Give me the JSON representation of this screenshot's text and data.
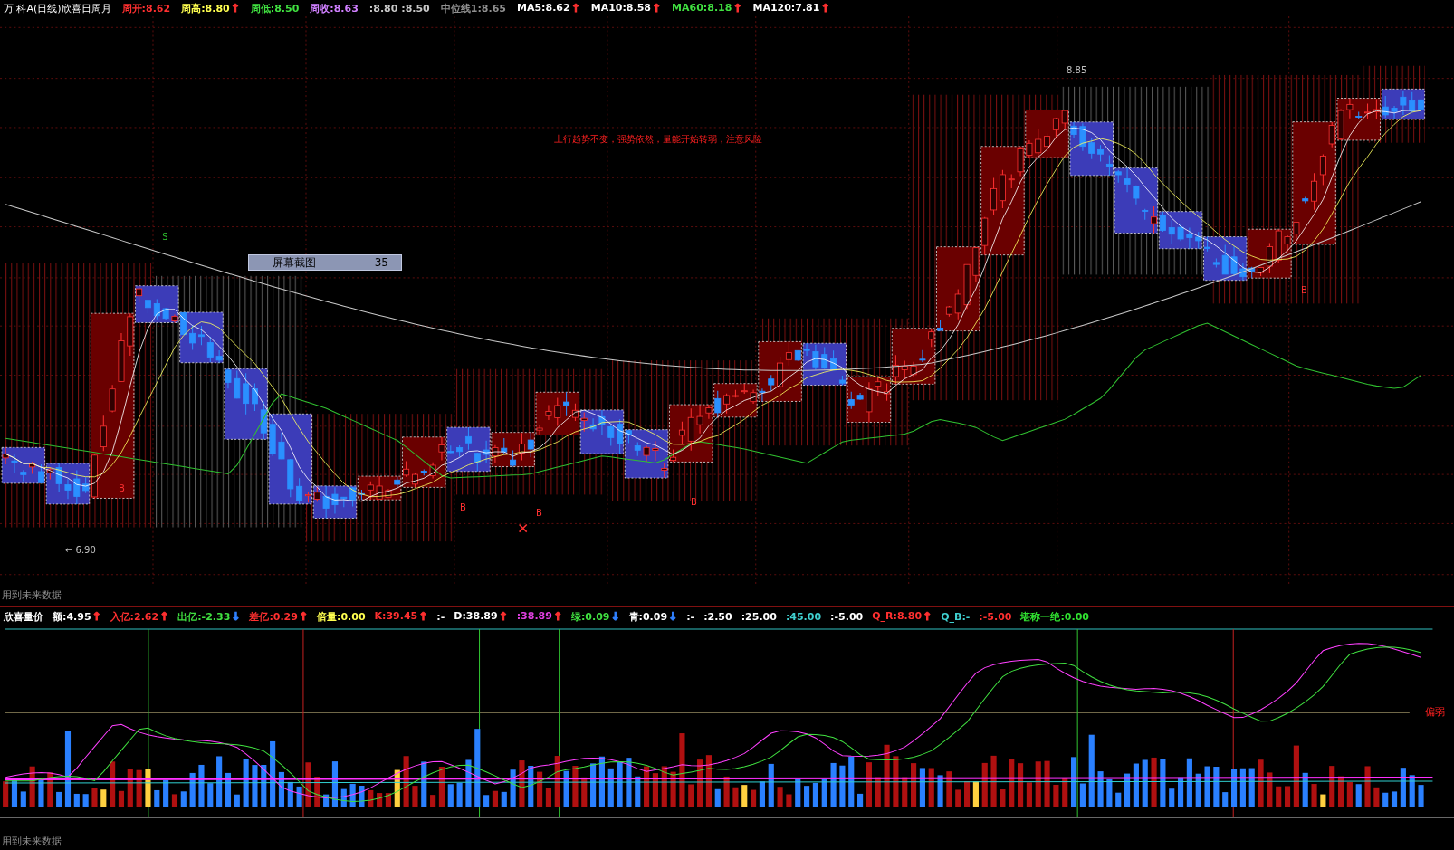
{
  "header": {
    "title": "万 科A(日线)欣喜日周月",
    "items": [
      {
        "text": "周开:8.62",
        "color": "#ff3030"
      },
      {
        "text": "周高:8.80",
        "color": "#ffff50",
        "arrow": {
          "text": "↑",
          "color": "#ff3030"
        }
      },
      {
        "text": "周低:8.50",
        "color": "#40e040"
      },
      {
        "text": "周收:8.63",
        "color": "#d080ff"
      },
      {
        "text": ":8.80 :8.50",
        "color": "#c8c8c8"
      },
      {
        "text": "中位线1:8.65",
        "color": "#909090"
      },
      {
        "text": "MA5:8.62",
        "color": "#ffffff",
        "arrow": {
          "text": "↑",
          "color": "#ff3030"
        }
      },
      {
        "text": "MA10:8.58",
        "color": "#ffffff",
        "arrow": {
          "text": "↑",
          "color": "#ff3030"
        }
      },
      {
        "text": "MA60:8.18",
        "color": "#40e040",
        "arrow": {
          "text": "↑",
          "color": "#ff3030"
        }
      },
      {
        "text": "MA120:7.81",
        "color": "#ffffff",
        "arrow": {
          "text": "↑",
          "color": "#ff3030"
        }
      }
    ]
  },
  "main_chart": {
    "annotation": "上行趋势不变，强势依然，量能开始转弱，注意风险",
    "screenshot_label": {
      "text": "屏幕截图",
      "count": "35"
    },
    "high_label": "8.85",
    "low_label": "← 6.90",
    "signals": [
      "S",
      "B",
      "B",
      "B",
      "B",
      "B"
    ],
    "note": "用到未来数据"
  },
  "indicator": {
    "items": [
      {
        "text": "欣喜量价",
        "color": "#ffffff"
      },
      {
        "text": "额:4.95",
        "color": "#ffffff",
        "arrow": {
          "text": "↑",
          "color": "#ff3030"
        }
      },
      {
        "text": "入亿:2.62",
        "color": "#ff3030",
        "arrow": {
          "text": "↑",
          "color": "#ff3030"
        }
      },
      {
        "text": "出亿:-2.33",
        "color": "#40e040",
        "arrow": {
          "text": "↓",
          "color": "#3080ff"
        }
      },
      {
        "text": "差亿:0.29",
        "color": "#ff3030",
        "arrow": {
          "text": "↑",
          "color": "#ff3030"
        }
      },
      {
        "text": "倍量:0.00",
        "color": "#ffff50"
      },
      {
        "text": "K:39.45",
        "color": "#ff3030",
        "arrow": {
          "text": "↑",
          "color": "#ff3030"
        }
      },
      {
        "text": ":-",
        "color": "#ffffff"
      },
      {
        "text": "D:38.89",
        "color": "#ffffff",
        "arrow": {
          "text": "↑",
          "color": "#ff3030"
        }
      },
      {
        "text": ":38.89",
        "color": "#e040e0",
        "arrow": {
          "text": "↑",
          "color": "#ff3030"
        }
      },
      {
        "text": "绿:0.09",
        "color": "#40e040",
        "arrow": {
          "text": "↓",
          "color": "#3080ff"
        }
      },
      {
        "text": "青:0.09",
        "color": "#ffffff",
        "arrow": {
          "text": "↓",
          "color": "#3080ff"
        }
      },
      {
        "text": ":-",
        "color": "#ffffff"
      },
      {
        "text": ":2.50",
        "color": "#ffffff"
      },
      {
        "text": ":25.00",
        "color": "#ffffff"
      },
      {
        "text": ":45.00",
        "color": "#40d0d0"
      },
      {
        "text": ":-5.00",
        "color": "#ffffff"
      },
      {
        "text": "Q_R:8.80",
        "color": "#ff3030",
        "arrow": {
          "text": "↑",
          "color": "#ff3030"
        }
      },
      {
        "text": "Q_B:-",
        "color": "#40d0d0"
      },
      {
        "text": ":-5.00",
        "color": "#ff3030"
      },
      {
        "text": "堪称一绝:0.00",
        "color": "#30e030"
      }
    ],
    "side_label": "偏弱",
    "note": "用到未来数据"
  }
}
